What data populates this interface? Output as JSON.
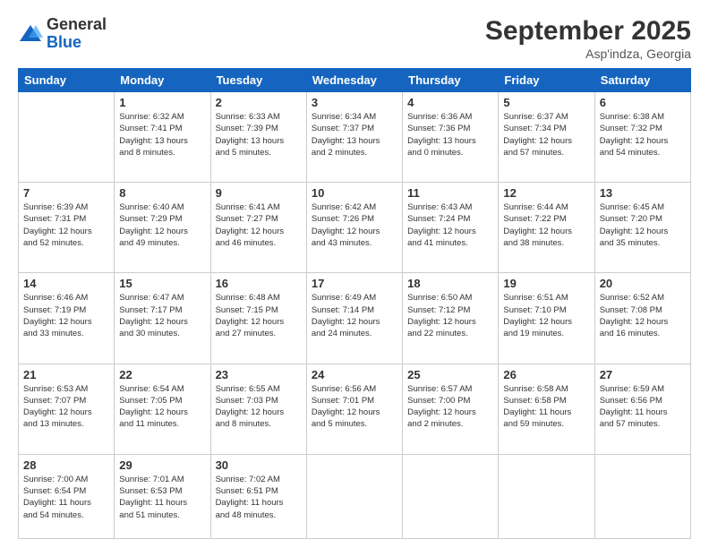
{
  "logo": {
    "general": "General",
    "blue": "Blue"
  },
  "header": {
    "month": "September 2025",
    "location": "Asp'indza, Georgia"
  },
  "weekdays": [
    "Sunday",
    "Monday",
    "Tuesday",
    "Wednesday",
    "Thursday",
    "Friday",
    "Saturday"
  ],
  "weeks": [
    [
      {
        "day": "",
        "info": ""
      },
      {
        "day": "1",
        "info": "Sunrise: 6:32 AM\nSunset: 7:41 PM\nDaylight: 13 hours\nand 8 minutes."
      },
      {
        "day": "2",
        "info": "Sunrise: 6:33 AM\nSunset: 7:39 PM\nDaylight: 13 hours\nand 5 minutes."
      },
      {
        "day": "3",
        "info": "Sunrise: 6:34 AM\nSunset: 7:37 PM\nDaylight: 13 hours\nand 2 minutes."
      },
      {
        "day": "4",
        "info": "Sunrise: 6:36 AM\nSunset: 7:36 PM\nDaylight: 13 hours\nand 0 minutes."
      },
      {
        "day": "5",
        "info": "Sunrise: 6:37 AM\nSunset: 7:34 PM\nDaylight: 12 hours\nand 57 minutes."
      },
      {
        "day": "6",
        "info": "Sunrise: 6:38 AM\nSunset: 7:32 PM\nDaylight: 12 hours\nand 54 minutes."
      }
    ],
    [
      {
        "day": "7",
        "info": "Sunrise: 6:39 AM\nSunset: 7:31 PM\nDaylight: 12 hours\nand 52 minutes."
      },
      {
        "day": "8",
        "info": "Sunrise: 6:40 AM\nSunset: 7:29 PM\nDaylight: 12 hours\nand 49 minutes."
      },
      {
        "day": "9",
        "info": "Sunrise: 6:41 AM\nSunset: 7:27 PM\nDaylight: 12 hours\nand 46 minutes."
      },
      {
        "day": "10",
        "info": "Sunrise: 6:42 AM\nSunset: 7:26 PM\nDaylight: 12 hours\nand 43 minutes."
      },
      {
        "day": "11",
        "info": "Sunrise: 6:43 AM\nSunset: 7:24 PM\nDaylight: 12 hours\nand 41 minutes."
      },
      {
        "day": "12",
        "info": "Sunrise: 6:44 AM\nSunset: 7:22 PM\nDaylight: 12 hours\nand 38 minutes."
      },
      {
        "day": "13",
        "info": "Sunrise: 6:45 AM\nSunset: 7:20 PM\nDaylight: 12 hours\nand 35 minutes."
      }
    ],
    [
      {
        "day": "14",
        "info": "Sunrise: 6:46 AM\nSunset: 7:19 PM\nDaylight: 12 hours\nand 33 minutes."
      },
      {
        "day": "15",
        "info": "Sunrise: 6:47 AM\nSunset: 7:17 PM\nDaylight: 12 hours\nand 30 minutes."
      },
      {
        "day": "16",
        "info": "Sunrise: 6:48 AM\nSunset: 7:15 PM\nDaylight: 12 hours\nand 27 minutes."
      },
      {
        "day": "17",
        "info": "Sunrise: 6:49 AM\nSunset: 7:14 PM\nDaylight: 12 hours\nand 24 minutes."
      },
      {
        "day": "18",
        "info": "Sunrise: 6:50 AM\nSunset: 7:12 PM\nDaylight: 12 hours\nand 22 minutes."
      },
      {
        "day": "19",
        "info": "Sunrise: 6:51 AM\nSunset: 7:10 PM\nDaylight: 12 hours\nand 19 minutes."
      },
      {
        "day": "20",
        "info": "Sunrise: 6:52 AM\nSunset: 7:08 PM\nDaylight: 12 hours\nand 16 minutes."
      }
    ],
    [
      {
        "day": "21",
        "info": "Sunrise: 6:53 AM\nSunset: 7:07 PM\nDaylight: 12 hours\nand 13 minutes."
      },
      {
        "day": "22",
        "info": "Sunrise: 6:54 AM\nSunset: 7:05 PM\nDaylight: 12 hours\nand 11 minutes."
      },
      {
        "day": "23",
        "info": "Sunrise: 6:55 AM\nSunset: 7:03 PM\nDaylight: 12 hours\nand 8 minutes."
      },
      {
        "day": "24",
        "info": "Sunrise: 6:56 AM\nSunset: 7:01 PM\nDaylight: 12 hours\nand 5 minutes."
      },
      {
        "day": "25",
        "info": "Sunrise: 6:57 AM\nSunset: 7:00 PM\nDaylight: 12 hours\nand 2 minutes."
      },
      {
        "day": "26",
        "info": "Sunrise: 6:58 AM\nSunset: 6:58 PM\nDaylight: 11 hours\nand 59 minutes."
      },
      {
        "day": "27",
        "info": "Sunrise: 6:59 AM\nSunset: 6:56 PM\nDaylight: 11 hours\nand 57 minutes."
      }
    ],
    [
      {
        "day": "28",
        "info": "Sunrise: 7:00 AM\nSunset: 6:54 PM\nDaylight: 11 hours\nand 54 minutes."
      },
      {
        "day": "29",
        "info": "Sunrise: 7:01 AM\nSunset: 6:53 PM\nDaylight: 11 hours\nand 51 minutes."
      },
      {
        "day": "30",
        "info": "Sunrise: 7:02 AM\nSunset: 6:51 PM\nDaylight: 11 hours\nand 48 minutes."
      },
      {
        "day": "",
        "info": ""
      },
      {
        "day": "",
        "info": ""
      },
      {
        "day": "",
        "info": ""
      },
      {
        "day": "",
        "info": ""
      }
    ]
  ]
}
